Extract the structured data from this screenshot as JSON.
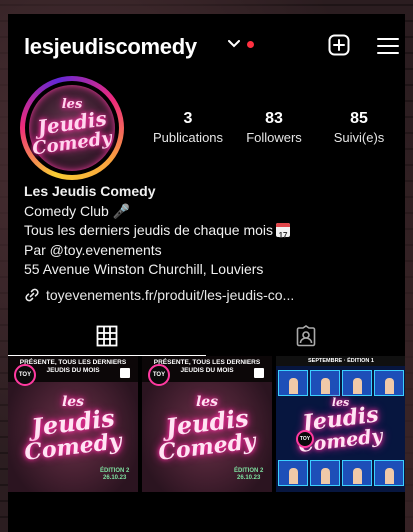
{
  "header": {
    "username": "lesjeudiscomedy",
    "notification_color": "#ff3040",
    "icons": [
      "chevron-down-icon",
      "plus-square-icon",
      "menu-icon"
    ]
  },
  "profile": {
    "avatar_text_line1": "les",
    "avatar_text_line2": "Jeudis",
    "avatar_text_line3": "Comedy",
    "stats": {
      "posts_count": "3",
      "posts_label": "Publications",
      "followers_count": "83",
      "followers_label": "Followers",
      "following_count": "85",
      "following_label": "Suivi(e)s"
    }
  },
  "bio": {
    "name": "Les Jeudis Comedy",
    "category": "Comedy Club 🎤",
    "line1": "Tous les derniers jeudis de chaque mois",
    "calendar_day": "17",
    "line2": "Par @toy.evenements",
    "line3": "55 Avenue Winston Churchill, Louviers"
  },
  "link": {
    "text": "toyevenements.fr/produit/les-jeudis-co..."
  },
  "tabs": [
    "grid-icon",
    "tagged-icon"
  ],
  "posts": [
    {
      "header": "PRÉSENTE, TOUS LES DERNIERS JEUDIS DU MOIS",
      "badge": "TOY",
      "title1": "les",
      "title2": "Jeudis",
      "title3": "Comedy",
      "edition": "ÉDITION 2",
      "date": "26.10.23"
    },
    {
      "header": "PRÉSENTE, TOUS LES DERNIERS JEUDIS DU MOIS",
      "badge": "TOY",
      "title1": "les",
      "title2": "Jeudis",
      "title3": "Comedy",
      "edition": "ÉDITION 2",
      "date": "26.10.23"
    },
    {
      "header": "SEPTEMBRE · ÉDITION 1",
      "badge": "TOY",
      "title1": "les",
      "title2": "Jeudis",
      "title3": "Comedy"
    }
  ]
}
